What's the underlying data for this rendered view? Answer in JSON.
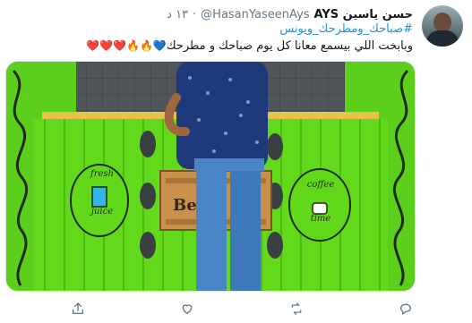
{
  "tweet": {
    "display_name": "حسن ياسين AYS",
    "handle": "@HasanYaseenAys",
    "separator": "·",
    "time": "١٣ د",
    "hashtag": "#صباحك_ومطرحك_ويونس",
    "text": "وبابخت اللي بيسمع معانا كل يوم صباحك و مطرحك",
    "emojis": "💙🔥🔥❤️❤️❤️"
  },
  "media": {
    "sign_left_line1": "fresh",
    "sign_left_line2": "juice",
    "sign_right_line1": "coffee",
    "sign_right_line2": "time",
    "center_sign": "Be"
  },
  "actions": {
    "share_icon": "share-icon",
    "like_icon": "heart-icon",
    "retweet_icon": "retweet-icon",
    "reply_icon": "reply-icon"
  },
  "colors": {
    "link": "#1b95e0",
    "muted": "#657786",
    "kiosk_green": "#62d81a"
  }
}
